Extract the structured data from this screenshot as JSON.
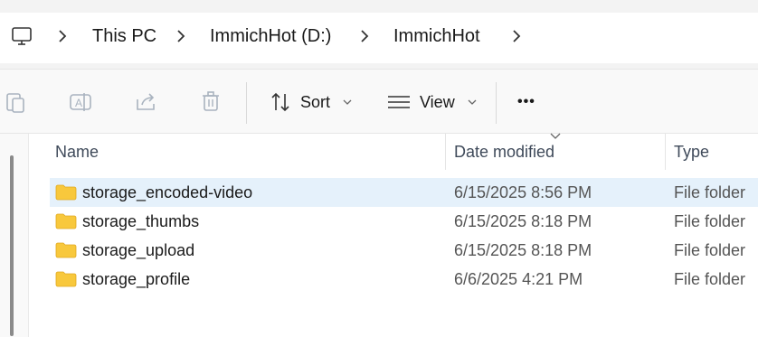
{
  "breadcrumb": {
    "root_icon": "computer-icon",
    "items": [
      "This PC",
      "ImmichHot (D:)",
      "ImmichHot"
    ]
  },
  "toolbar": {
    "sort_label": "Sort",
    "view_label": "View",
    "more_label": "•••",
    "icons": [
      "paste-icon",
      "rename-icon",
      "share-icon",
      "delete-icon",
      "sort-icon",
      "view-icon",
      "more-icon"
    ]
  },
  "columns": {
    "name": "Name",
    "date_modified": "Date modified",
    "type": "Type"
  },
  "files": [
    {
      "name": "storage_encoded-video",
      "date": "6/15/2025 8:56 PM",
      "type": "File folder",
      "selected": true
    },
    {
      "name": "storage_thumbs",
      "date": "6/15/2025 8:18 PM",
      "type": "File folder",
      "selected": false
    },
    {
      "name": "storage_upload",
      "date": "6/15/2025 8:18 PM",
      "type": "File folder",
      "selected": false
    },
    {
      "name": "storage_profile",
      "date": "6/6/2025 4:21 PM",
      "type": "File folder",
      "selected": false
    }
  ],
  "colors": {
    "selected_row": "#e5f1fb",
    "folder_yellow": "#f8c83c"
  }
}
